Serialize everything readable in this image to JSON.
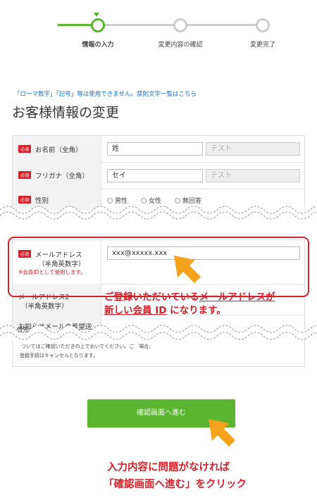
{
  "stepper": {
    "steps": [
      {
        "label": "情報の入力"
      },
      {
        "label": "変更内容の確認"
      },
      {
        "label": "変更完了"
      }
    ],
    "colors": {
      "active": "#5cb531",
      "inactive": "#cccccc"
    }
  },
  "notice": "「ローマ数字」「記号」等は使用できません。禁則文字一覧はこちら",
  "page_title": "お客様情報の変更",
  "required_badge": "必須",
  "form": {
    "name": {
      "label": "お名前（全角）",
      "value": "姓",
      "placeholder": "テスト"
    },
    "kana": {
      "label": "フリガナ（全角）",
      "value": "セイ",
      "placeholder": "テスト"
    },
    "gender": {
      "label": "性別",
      "options": [
        "男性",
        "女性",
        "無回答"
      ]
    },
    "email": {
      "label": "メールアドレス",
      "sublabel": "（半角英数字）",
      "note": "※会員IDとして使用します。",
      "value": "xxx@xxxxx.xxx"
    },
    "email2": {
      "label": "メールアドレス2",
      "sublabel": "（半角英数字）"
    },
    "newsletter": {
      "label_top": "お知らせメールの希望送",
      "label_bottom": "付先",
      "bottom_text_1": "ついてはご確認いただきの上でおいてください。ご",
      "bottom_text_1b": "場合、",
      "bottom_text_2": "登録手続はキャンセルとなります。"
    }
  },
  "annotation_email": {
    "line1_pre": "ご登録いただいている",
    "line1_u": "メールアドレスが",
    "line2_u": "新しい会員 ID",
    "line2_post": " になります。"
  },
  "submit_button": "確認画面へ進む",
  "annotation_button": {
    "line1": "入力内容に問題がなければ",
    "line2": "「確認画面へ進む」をクリック"
  },
  "colors": {
    "accent": "#5cb531",
    "alert": "#d6202a",
    "arrow": "#f5a11c",
    "link": "#1a6fc7"
  }
}
